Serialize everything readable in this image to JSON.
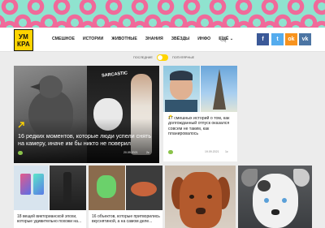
{
  "header": {
    "logo": {
      "line1": "УМ",
      "line2": "КРА"
    },
    "nav": [
      "Смешное",
      "Истории",
      "Животные",
      "Знания",
      "Звёзды",
      "Инфо",
      "Ещё ⌄"
    ],
    "social": {
      "facebook": "f",
      "twitter": "t",
      "odnoklassniki": "ok",
      "vkontakte": "vk"
    }
  },
  "toggle": {
    "left_label": "Последние",
    "right_label": "Популярные",
    "active": "left"
  },
  "feature": {
    "title": "16 редких моментов, которые люди успели снять на камеру, иначе им бы никто не поверил",
    "tag": "",
    "date": "20.09.2021",
    "views": "2к",
    "photo_caption": "SARCASTIC"
  },
  "side": {
    "title": "17 смешных историй о том, как долгожданный отпуск оказался совсем не таким, как планировалось",
    "tag": "",
    "date": "19.09.2021",
    "views": "1к"
  },
  "bottom_cards": [
    {
      "title": "18 вещей викторианской эпохи, которые удивительно похожи на..."
    },
    {
      "title": "16 объектов, которые притворились вкуснятиной, а на самом деле..."
    }
  ],
  "colors": {
    "accent_yellow": "#ffd400",
    "badge_green": "#8bc34a",
    "banner_mint": "#8fe3cf",
    "banner_pink": "#f06a9a"
  }
}
